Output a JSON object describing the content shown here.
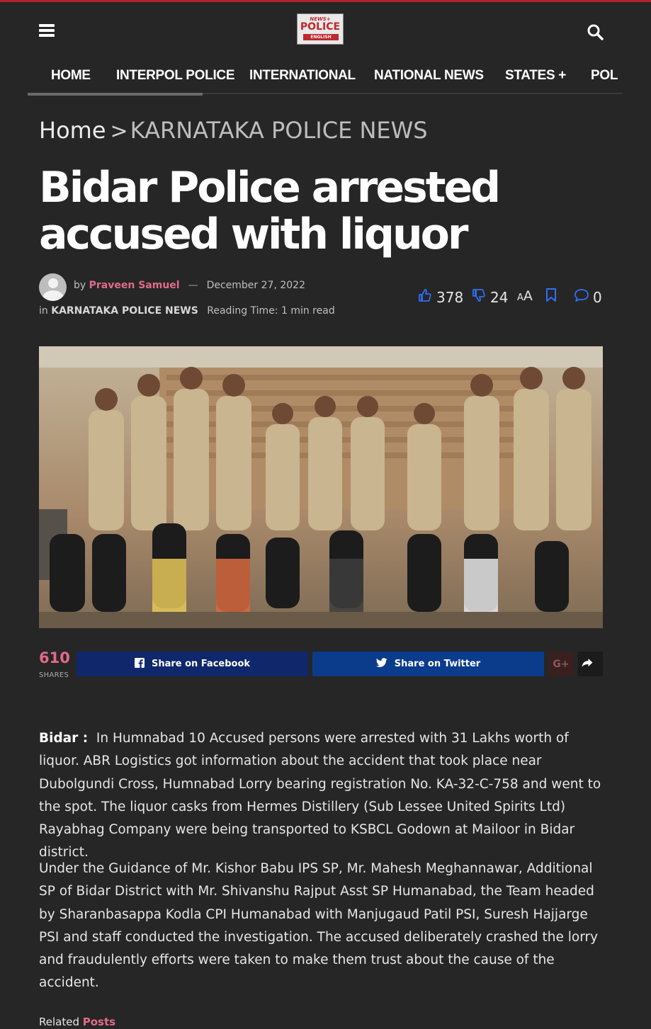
{
  "header": {
    "logo": {
      "line1": "NEWS+",
      "line2": "POLICE",
      "line3": "ENGLISH"
    }
  },
  "nav": {
    "items": [
      "HOME",
      "INTERPOL POLICE",
      "INTERNATIONAL",
      "NATIONAL NEWS",
      "STATES +",
      "POL"
    ]
  },
  "breadcrumb": {
    "home": "Home",
    "separator": ">",
    "category": "KARNATAKA POLICE NEWS"
  },
  "article": {
    "title_line1": "Bidar Police arrested",
    "title_line2": "accused with liquor",
    "by": "by",
    "author": "Praveen Samuel",
    "dash": "—",
    "date": "December 27, 2022",
    "in": "in",
    "category": "KARNATAKA POLICE NEWS",
    "reading_time": "Reading Time: 1 min read",
    "likes": "378",
    "dislikes": "24",
    "font_size_small": "A",
    "font_size_large": "A",
    "comments": "0",
    "p1_lead": "Bidar :",
    "p1_text": "In Humnabad 10 Accused persons were arrested with 31 Lakhs worth of liquor. ABR Logistics got information about the accident that took place near Dubolgundi Cross, Humnabad Lorry bearing registration No. KA-32-C-758 and went to the spot. The liquor casks from Hermes Distillery (Sub Lessee United Spirits Ltd) Rayabhag Company were being transported to KSBCL Godown at Mailoor in Bidar district.",
    "p2_text": "Under the Guidance of Mr. Kishor Babu IPS SP, Mr. Mahesh Meghannawar, Additional SP of Bidar District with Mr. Shivanshu Rajput Asst SP Humanabad, the Team headed by Sharanbasappa Kodla CPI Humanabad with Manjugaud Patil PSI, Suresh Hajjarge PSI and staff conducted the investigation. The accused deliberately crashed the lorry and fraudulently efforts were taken to make them trust about the cause of the accident."
  },
  "share": {
    "count": "610",
    "label": "SHARES",
    "facebook": "Share on Facebook",
    "twitter": "Share on Twitter",
    "gplus": "G+"
  },
  "related": {
    "prefix": "Related",
    "suffix": "Posts"
  },
  "colors": {
    "background": "#262626",
    "accent": "#e26a8a",
    "facebook": "#10276b",
    "twitter": "#0b3c8c",
    "icon_blue": "#2f6ff5",
    "top_border": "#b4232a"
  },
  "icons": {
    "menu": "hamburger-icon",
    "search": "search-icon",
    "like": "thumbs-up-icon",
    "dislike": "thumbs-down-icon",
    "bookmark": "bookmark-icon",
    "comment": "comment-icon",
    "facebook": "facebook-icon",
    "twitter": "twitter-icon",
    "share": "share-arrow-icon"
  }
}
